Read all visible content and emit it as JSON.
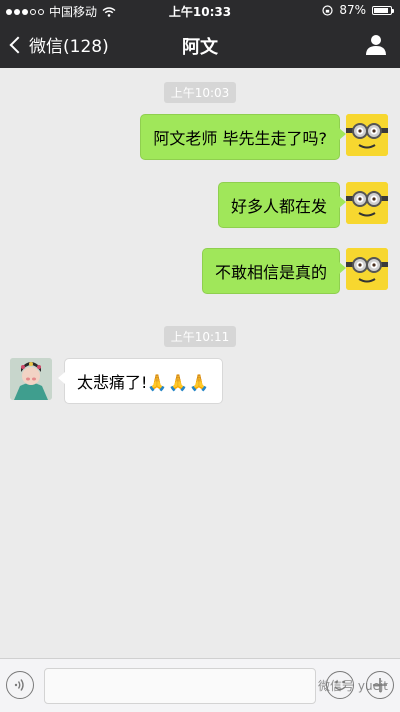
{
  "status": {
    "carrier": "中国移动",
    "time": "上午10:33",
    "battery": "87%",
    "battery_level": 0.87
  },
  "nav": {
    "back_label": "微信(128)",
    "title": "阿文"
  },
  "chat": {
    "timestamp1": "上午10:03",
    "msg1": "阿文老师 毕先生走了吗?",
    "msg2": "好多人都在发",
    "msg3": "不敢相信是真的",
    "timestamp2": "上午10:11",
    "reply_text": "太悲痛了!",
    "reply_emoji": "🙏🙏🙏"
  },
  "input": {
    "value": "",
    "placeholder": ""
  },
  "watermark": "微信号 yuejt"
}
